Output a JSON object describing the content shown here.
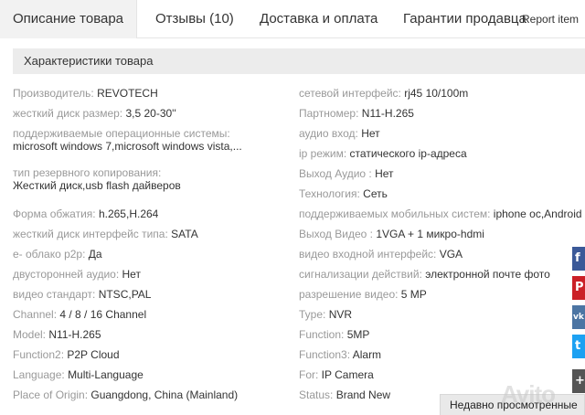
{
  "tabs": {
    "description": "Описание товара",
    "reviews": "Отзывы (10)",
    "delivery": "Доставка и оплата",
    "guarantee": "Гарантии продавца",
    "report": "Report item"
  },
  "section": {
    "title": "Характеристики товара"
  },
  "left": [
    {
      "k": "Производитель: ",
      "v": "REVOTECH"
    },
    {
      "k": "жесткий диск размер: ",
      "v": "3,5 20-30''"
    },
    {
      "k": "поддерживаемые операционные системы:",
      "v": "microsoft windows 7,microsoft windows vista,..."
    },
    {
      "k": "тип резервного копирования:",
      "v": "Жесткий диск,usb flash дайверов"
    },
    {
      "k": "Форма обжатия: ",
      "v": "h.265,H.264"
    },
    {
      "k": "жесткий диск интерфейс типа: ",
      "v": "SATA"
    },
    {
      "k": "е- облако p2p: ",
      "v": "Да"
    },
    {
      "k": "двусторонней аудио: ",
      "v": "Нет"
    },
    {
      "k": "видео стандарт: ",
      "v": "NTSC,PAL"
    },
    {
      "k": "Channel: ",
      "v": "4 / 8 / 16 Channel"
    },
    {
      "k": "Model: ",
      "v": "N11-H.265"
    },
    {
      "k": "Function2: ",
      "v": "P2P Cloud"
    },
    {
      "k": "Language: ",
      "v": "Multi-Language"
    },
    {
      "k": "Place of Origin: ",
      "v": "Guangdong, China (Mainland)"
    }
  ],
  "right": [
    {
      "k": "сетевой интерфейс: ",
      "v": "rj45 10/100m"
    },
    {
      "k": "Партномер: ",
      "v": "N11-H.265"
    },
    {
      "k": "аудио вход: ",
      "v": "Нет"
    },
    {
      "k": "ip режим: ",
      "v": "статического ip-адреса"
    },
    {
      "k": "Выход Аудио : ",
      "v": "Нет"
    },
    {
      "k": "Технология: ",
      "v": "Сеть"
    },
    {
      "k": "поддерживаемых мобильных систем: ",
      "v": "iphone ос,Android"
    },
    {
      "k": "Выход Видео : ",
      "v": "1VGA + 1 микро-hdmi"
    },
    {
      "k": "видео входной интерфейс: ",
      "v": "VGA"
    },
    {
      "k": "сигнализации действий: ",
      "v": "электронной почте фото"
    },
    {
      "k": "разрешение видео: ",
      "v": "5 MP"
    },
    {
      "k": "Type: ",
      "v": "NVR"
    },
    {
      "k": "Function: ",
      "v": "5MP"
    },
    {
      "k": "Function3: ",
      "v": "Alarm"
    },
    {
      "k": "For: ",
      "v": "IP Camera"
    },
    {
      "k": "Status: ",
      "v": "Brand New"
    }
  ],
  "social": {
    "fb": "f",
    "pin": "P",
    "vk": "vk",
    "tw": "t",
    "more": "+"
  },
  "recent": {
    "label": "Недавно просмотренные"
  },
  "watermark": {
    "text": "Avito"
  }
}
